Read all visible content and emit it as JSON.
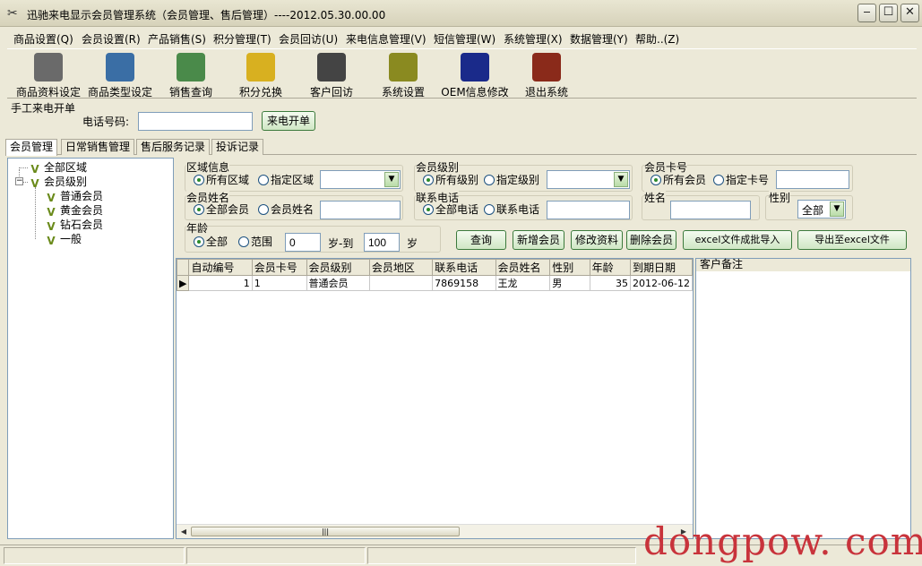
{
  "window": {
    "title": "迅驰来电显示会员管理系统（会员管理、售后管理）----2012.05.30.00.00"
  },
  "menu": [
    "商品设置(Q)",
    "会员设置(R)",
    "产品销售(S)",
    "积分管理(T)",
    "会员回访(U)",
    "来电信息管理(V)",
    "短信管理(W)",
    "系统管理(X)",
    "数据管理(Y)",
    "帮助..(Z)"
  ],
  "toolbar": [
    {
      "label": "商品资料设定",
      "icon": "printer-icon",
      "color": "#555"
    },
    {
      "label": "商品类型设定",
      "icon": "keyboard-icon",
      "color": "#3a6ea5"
    },
    {
      "label": "销售查询",
      "icon": "computer-icon",
      "color": "#4a8a4a"
    },
    {
      "label": "积分兑换",
      "icon": "pencil-icon",
      "color": "#d8b020"
    },
    {
      "label": "客户回访",
      "icon": "city-icon",
      "color": "#444"
    },
    {
      "label": "系统设置",
      "icon": "gear-icon",
      "color": "#8a8a20"
    },
    {
      "label": "OEM信息修改",
      "icon": "note-icon",
      "color": "#1a2a8a"
    },
    {
      "label": "退出系统",
      "icon": "tv-icon",
      "color": "#8a2a1a"
    }
  ],
  "phone": {
    "section_title": "手工来电开单",
    "label": "电话号码:",
    "value": "",
    "button": "来电开单"
  },
  "tabs": [
    "会员管理",
    "日常销售管理",
    "售后服务记录",
    "投诉记录"
  ],
  "tree": {
    "root1": "全部区域",
    "root2": "会员级别",
    "children": [
      "普通会员",
      "黄金会员",
      "钻石会员",
      "一般"
    ]
  },
  "filters": {
    "region": {
      "title": "区域信息",
      "opt_all": "所有区域",
      "opt_specific": "指定区域",
      "value": ""
    },
    "level": {
      "title": "会员级别",
      "opt_all": "所有级别",
      "opt_specific": "指定级别",
      "value": ""
    },
    "card": {
      "title": "会员卡号",
      "opt_all": "所有会员",
      "opt_specific": "指定卡号",
      "value": ""
    },
    "name": {
      "title": "会员姓名",
      "opt_all": "全部会员",
      "opt_specific": "会员姓名",
      "value": ""
    },
    "phone": {
      "title": "联系电话",
      "opt_all": "全部电话",
      "opt_specific": "联系电话",
      "value": ""
    },
    "surname": {
      "title": "姓名",
      "value": ""
    },
    "gender": {
      "title": "性别",
      "value": "全部"
    },
    "age": {
      "title": "年龄",
      "opt_all": "全部",
      "opt_range": "范围",
      "from": "0",
      "to_label": "岁-到",
      "to": "100",
      "unit": "岁"
    }
  },
  "actions": [
    "查询",
    "新增会员",
    "修改资料",
    "删除会员",
    "excel文件成批导入",
    "导出至excel文件"
  ],
  "grid": {
    "columns": [
      "自动编号",
      "会员卡号",
      "会员级别",
      "会员地区",
      "联系电话",
      "会员姓名",
      "性别",
      "年龄",
      "到期日期"
    ],
    "rows": [
      [
        "1",
        "1",
        "普通会员",
        "",
        "7869158",
        "王龙",
        "男",
        "35",
        "2012-06-12"
      ]
    ]
  },
  "notes": {
    "title": "客户备注"
  },
  "watermark": "dongpow. com"
}
